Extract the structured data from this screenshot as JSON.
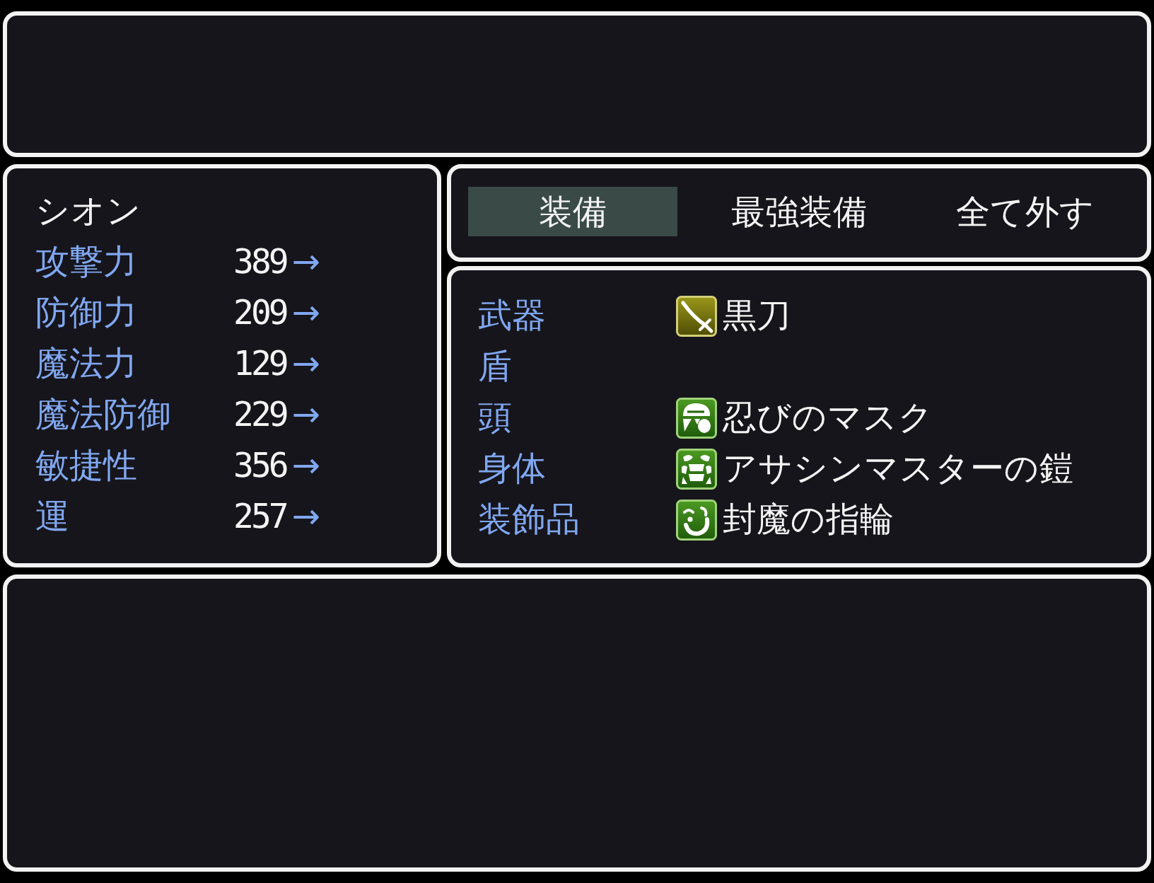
{
  "character": {
    "name": "シオン"
  },
  "stats": [
    {
      "label": "攻撃力",
      "value": "389",
      "arrow": "→"
    },
    {
      "label": "防御力",
      "value": "209",
      "arrow": "→"
    },
    {
      "label": "魔法力",
      "value": "129",
      "arrow": "→"
    },
    {
      "label": "魔法防御",
      "value": "229",
      "arrow": "→"
    },
    {
      "label": "敏捷性",
      "value": "356",
      "arrow": "→"
    },
    {
      "label": "運",
      "value": "257",
      "arrow": "→"
    }
  ],
  "commands": [
    {
      "label": "装備",
      "selected": true
    },
    {
      "label": "最強装備",
      "selected": false
    },
    {
      "label": "全て外す",
      "selected": false
    }
  ],
  "slots": [
    {
      "label": "武器",
      "item": {
        "name": "黒刀",
        "kind": "sword"
      }
    },
    {
      "label": "盾"
    },
    {
      "label": "頭",
      "item": {
        "name": "忍びのマスク",
        "kind": "mask"
      }
    },
    {
      "label": "身体",
      "item": {
        "name": "アサシンマスターの鎧",
        "kind": "armor"
      }
    },
    {
      "label": "装飾品",
      "item": {
        "name": "封魔の指輪",
        "kind": "ring"
      }
    }
  ]
}
